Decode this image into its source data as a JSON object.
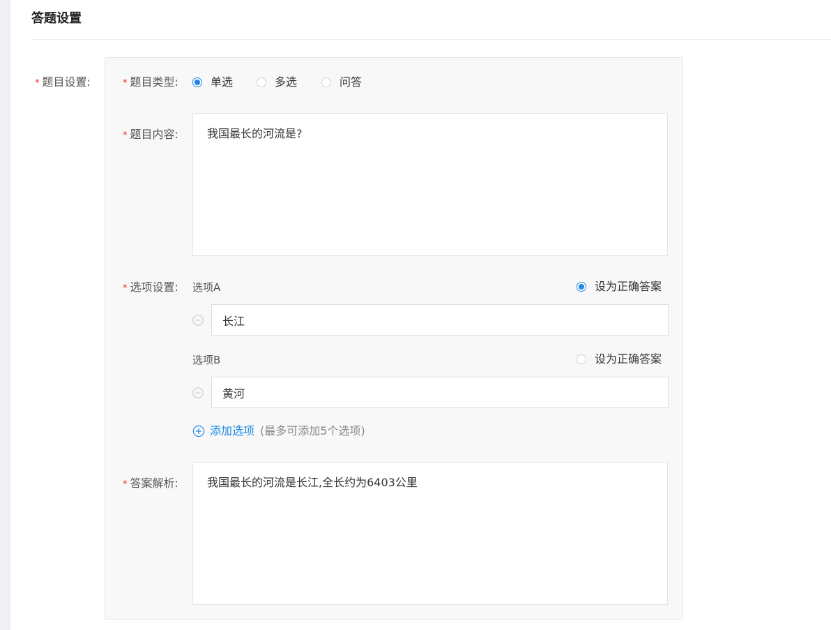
{
  "section": {
    "title": "答题设置"
  },
  "labels": {
    "question_settings": "题目设置:",
    "question_type": "题目类型:",
    "question_content": "题目内容:",
    "option_settings": "选项设置:",
    "answer_analysis": "答案解析:"
  },
  "question_type": {
    "options": [
      {
        "label": "单选",
        "checked": true
      },
      {
        "label": "多选",
        "checked": false
      },
      {
        "label": "问答",
        "checked": false
      }
    ]
  },
  "question_content": {
    "value": "我国最长的河流是?"
  },
  "options": [
    {
      "title": "选项A",
      "value": "长江",
      "correct_label": "设为正确答案",
      "correct": true
    },
    {
      "title": "选项B",
      "value": "黄河",
      "correct_label": "设为正确答案",
      "correct": false
    }
  ],
  "add_option": {
    "label": "添加选项",
    "hint": "(最多可添加5个选项)"
  },
  "answer_analysis": {
    "value": "我国最长的河流是长江,全长约为6403公里"
  },
  "colors": {
    "primary": "#1e88e5",
    "required": "#f5222d"
  }
}
